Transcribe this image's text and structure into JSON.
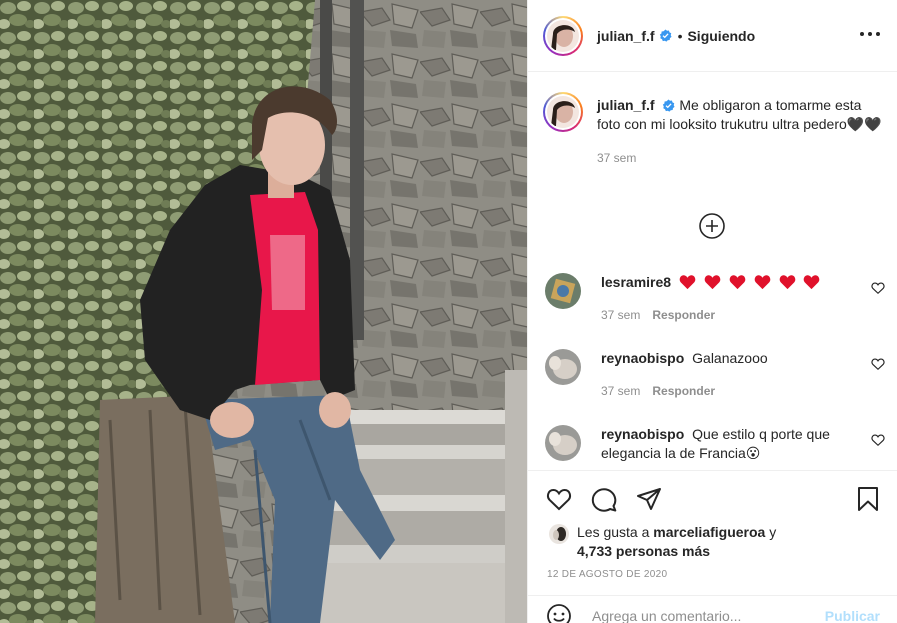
{
  "post": {
    "username": "julian_f.f",
    "verified": true,
    "separator": "•",
    "follow_status": "Siguiendo",
    "caption": "Me obligaron a tomarme esta foto con mi looksito trukutru ultra pedero🖤🖤",
    "caption_time": "37 sem"
  },
  "comments": [
    {
      "username": "lesramire8",
      "text": "",
      "hearts": 6,
      "time": "37 sem",
      "reply": "Responder"
    },
    {
      "username": "reynaobispo",
      "text": "Galanazooo",
      "time": "37 sem",
      "reply": "Responder"
    },
    {
      "username": "reynaobispo",
      "text": "Que estilo q porte que elegancia la de Francia😮"
    }
  ],
  "likes": {
    "prefix": "Les gusta a",
    "user": "marceliafigueroa",
    "conj": "y",
    "others": "4,733 personas más"
  },
  "date": "12 DE AGOSTO DE 2020",
  "add_comment": {
    "placeholder": "Agrega un comentario...",
    "publish": "Publicar"
  },
  "colors": {
    "accent": "#0095f6",
    "verified": "#3897f0",
    "heart_red": "#ed4956",
    "shirt": "#e8174a"
  },
  "icons": [
    "more-options-icon",
    "add-more-comments-icon",
    "like-icon",
    "comment-icon",
    "share-icon",
    "bookmark-icon",
    "emoji-icon",
    "comment-like-icon",
    "verified-badge-icon"
  ]
}
